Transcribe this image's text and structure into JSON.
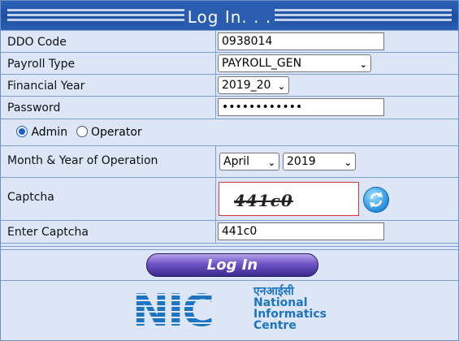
{
  "form": {
    "title": "Log In. . ."
  },
  "fields": {
    "ddo_code": {
      "label": "DDO Code",
      "value": "0938014"
    },
    "payroll_type": {
      "label": "Payroll Type",
      "value": "PAYROLL_GEN"
    },
    "financial_year": {
      "label": "Financial Year",
      "value": "2019_20"
    },
    "password": {
      "label": "Password",
      "value": "••••••••••••"
    },
    "role": {
      "admin_label": "Admin",
      "operator_label": "Operator",
      "selected": "Admin"
    },
    "month_year": {
      "label": "Month & Year of Operation",
      "month": "April",
      "year": "2019"
    },
    "captcha": {
      "label": "Captcha",
      "image_text": "441c0"
    },
    "enter_captcha": {
      "label": "Enter Captcha",
      "value": "441c0"
    }
  },
  "buttons": {
    "login_label": "Log In"
  },
  "logo": {
    "letters": "NIC",
    "hindi": "एनआईसी",
    "line1": "National",
    "line2": "Informatics",
    "line3": "Centre"
  },
  "colors": {
    "header_blue": "#1e4fa2",
    "panel_bg": "#dce6f7",
    "captcha_border": "#d33a3a",
    "logo_blue": "#1d74c2"
  }
}
